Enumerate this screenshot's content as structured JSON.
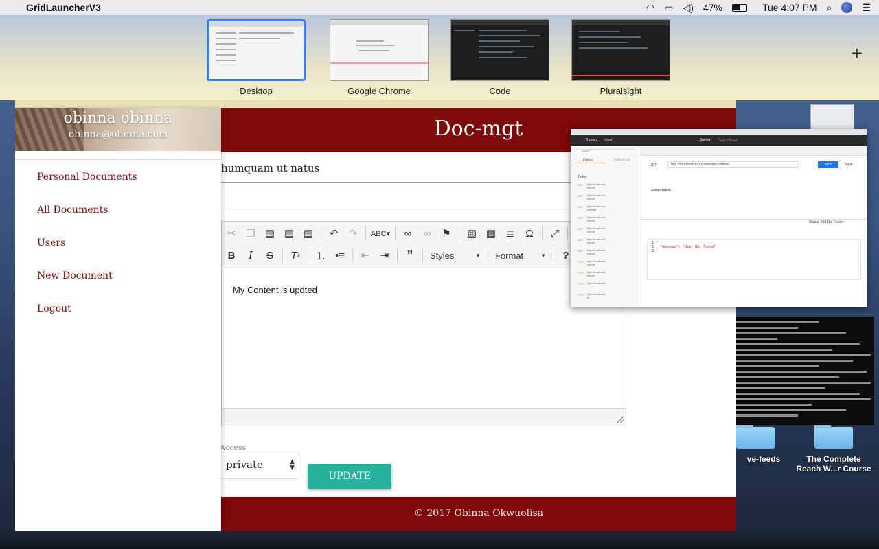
{
  "menubar": {
    "app_name": "GridLauncherV3",
    "battery": "47%",
    "clock": "Tue 4:07 PM"
  },
  "spaces": [
    {
      "label": "Desktop",
      "active": true
    },
    {
      "label": "Google Chrome",
      "active": false
    },
    {
      "label": "Code",
      "active": false
    },
    {
      "label": "Pluralsight",
      "active": false
    }
  ],
  "app": {
    "title": "Doc-mgt",
    "footer": "© 2017 Obinna Okwuolisa",
    "sidebar": {
      "user_name": "obinna obinna",
      "user_email": "obinna@obinna.com",
      "items": [
        {
          "label": "Personal Documents"
        },
        {
          "label": "All Documents"
        },
        {
          "label": "Users"
        },
        {
          "label": "New Document"
        },
        {
          "label": "Logout"
        }
      ]
    },
    "form": {
      "title_value": "humquam ut natus",
      "editor_content": "My Content is updted",
      "toolbar": {
        "styles_label": "Styles",
        "format_label": "Format"
      },
      "access_label": "Access",
      "access_value": "private",
      "update_label": "UPDATE"
    }
  },
  "postman": {
    "tabs": [
      "Runner",
      "Import"
    ],
    "builder_label": "Builder",
    "team_library_label": "Team Library",
    "filter_placeholder": "Filter",
    "history_label": "History",
    "collections_label": "Collections",
    "today_label": "Today",
    "method": "GET",
    "url": "http://localhost:3000/users/documents",
    "send_label": "Send",
    "save_label": "Save",
    "header_key": "authorization",
    "status": "Status: 404 Not Found",
    "response_body": "\"message\": \"User Not Found\""
  },
  "desktop": {
    "label_left": "ve-feeds",
    "label_right_1": "The Complete",
    "label_right_2": "Reach W...r Course"
  },
  "colors": {
    "brand_maroon": "#7d0909",
    "update_button": "#25b19b",
    "active_space_border": "#3a7ff2"
  }
}
